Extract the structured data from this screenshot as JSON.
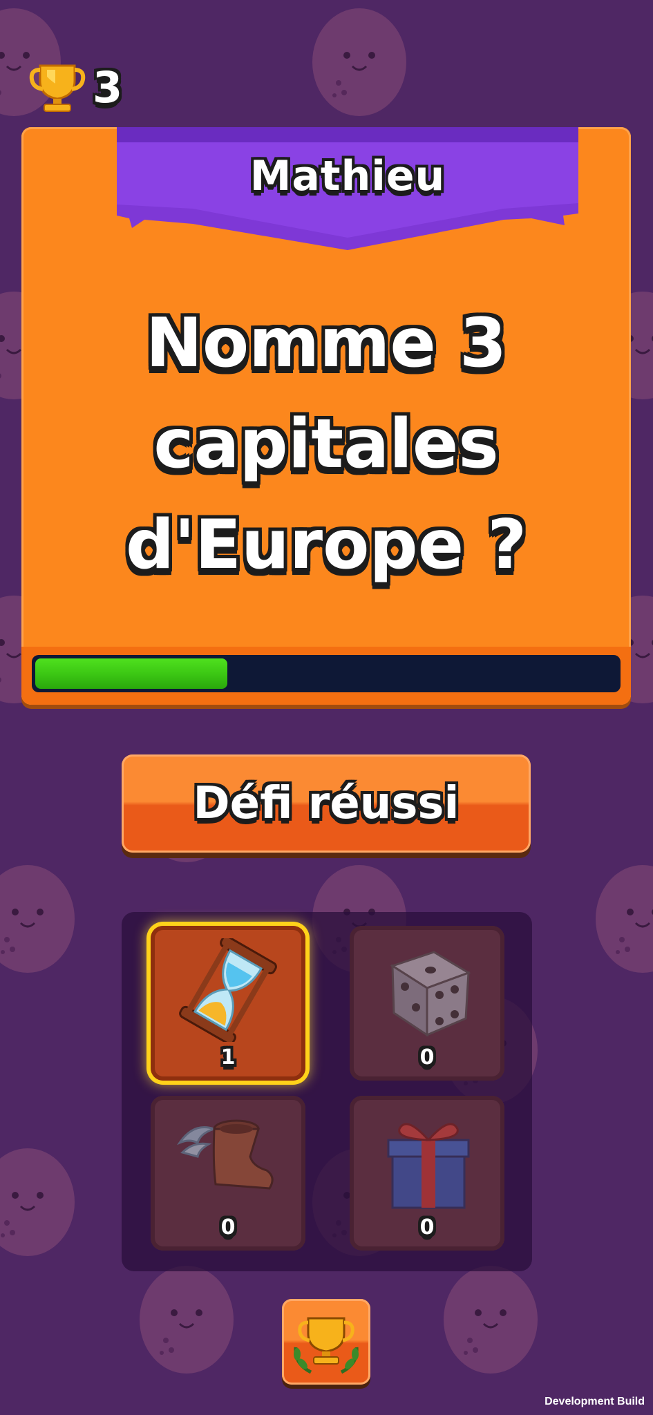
{
  "header": {
    "trophy_icon": "trophy-icon",
    "trophy_count": "3"
  },
  "card": {
    "player_name": "Mathieu",
    "question": "Nomme 3 capitales d'Europe ?",
    "timer_remaining_fraction": 0.33,
    "timer_color": "#3cc814"
  },
  "action": {
    "success_label": "Défi réussi"
  },
  "powerups": [
    {
      "name": "hourglass",
      "icon": "hourglass-icon",
      "count": "1",
      "selected": true
    },
    {
      "name": "dice",
      "icon": "dice-icon",
      "count": "0",
      "selected": false
    },
    {
      "name": "winged-boot",
      "icon": "winged-boot-icon",
      "count": "0",
      "selected": false
    },
    {
      "name": "gift",
      "icon": "gift-icon",
      "count": "0",
      "selected": false
    }
  ],
  "footer": {
    "leaderboard_icon": "trophy-laurel-icon",
    "build_label": "Development Build"
  },
  "colors": {
    "background": "#4f2764",
    "card": "#fc871d",
    "banner": "#7e38d6",
    "button": "#fb8a33"
  }
}
